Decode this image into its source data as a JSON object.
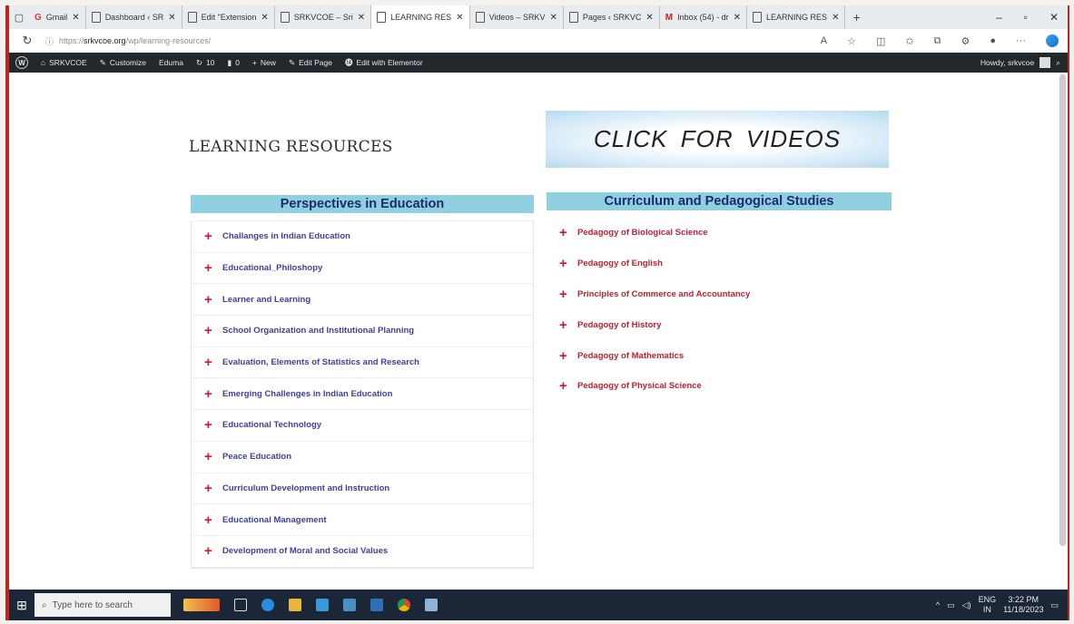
{
  "browser": {
    "tabs": [
      {
        "label": "Gmail",
        "icon": "gmail-icon",
        "active": false
      },
      {
        "label": "Dashboard ‹ SR",
        "icon": "page-icon",
        "active": false
      },
      {
        "label": "Edit \"Extension",
        "icon": "page-icon",
        "active": false
      },
      {
        "label": "SRKVCOE – Sri",
        "icon": "page-icon",
        "active": false
      },
      {
        "label": "LEARNING RES",
        "icon": "page-icon",
        "active": true
      },
      {
        "label": "Videos – SRKV",
        "icon": "page-icon",
        "active": false
      },
      {
        "label": "Pages ‹ SRKVC",
        "icon": "page-icon",
        "active": false
      },
      {
        "label": "Inbox (54) - dr",
        "icon": "mail-icon",
        "active": false
      },
      {
        "label": "LEARNING RES",
        "icon": "page-icon",
        "active": false
      }
    ],
    "url_prefix": "https://",
    "url_domain": "srkvcoe.org",
    "url_path": "/wp/learning-resources/"
  },
  "wpbar": {
    "site": "SRKVCOE",
    "customize": "Customize",
    "theme": "Eduma",
    "updates": "10",
    "comments": "0",
    "new": "New",
    "edit_page": "Edit Page",
    "elementor": "Edit with Elementor",
    "howdy": "Howdy, srkvcoe"
  },
  "page": {
    "title": "LEARNING RESOURCES",
    "video_button": "CLICK FOR VIDEOS",
    "left_heading": "Perspectives in Education",
    "right_heading": "Curriculum and Pedagogical Studies",
    "left_items": [
      "Challanges in Indian Education",
      "Educational_Philoshopy",
      "Learner and Learning",
      "School Organization and Institutional Planning",
      "Evaluation, Elements of Statistics and Research",
      "Emerging Challenges in Indian Education",
      "Educational Technology",
      "Peace Education",
      "Curriculum Development and Instruction",
      "Educational Management",
      "Development of Moral and Social Values"
    ],
    "right_items": [
      "Pedagogy of Biological Science",
      "Pedagogy of English",
      "Principles of Commerce and Accountancy",
      "Pedagogy of History",
      "Pedagogy of Mathematics",
      "Pedagogy of Physical Science"
    ]
  },
  "taskbar": {
    "search_placeholder": "Type here to search",
    "lang": "ENG",
    "region": "IN",
    "time": "3:22 PM",
    "date": "11/18/2023"
  },
  "colors": {
    "heading_bg": "#8fd0e0",
    "heading_text": "#1e2a6e",
    "left_link": "#3d3fa6",
    "right_link": "#c41d2f",
    "plus": "#d3162b",
    "wpbar": "#23282d",
    "taskbar": "#1b2736"
  }
}
